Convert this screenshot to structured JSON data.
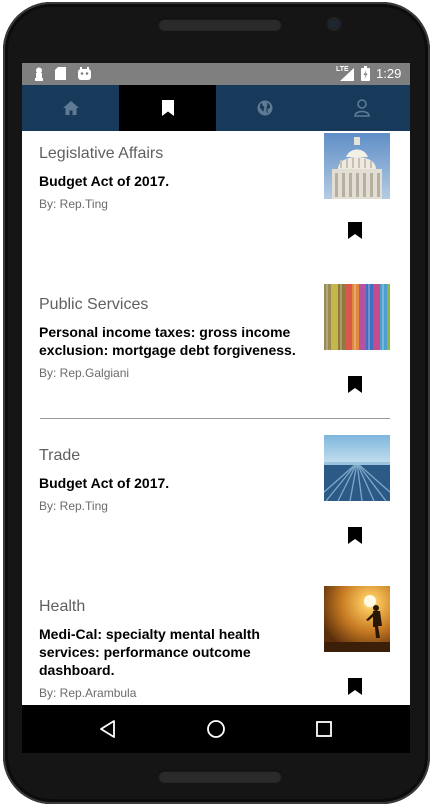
{
  "status_bar": {
    "network": "LTE",
    "time": "1:29",
    "icons": [
      "android-pawn-icon",
      "sd-card-icon",
      "android-robot-icon",
      "signal-icon",
      "battery-icon"
    ]
  },
  "tabs": [
    {
      "name": "home",
      "icon": "home-icon",
      "active": false
    },
    {
      "name": "bookmarks",
      "icon": "bookmark-icon",
      "active": true
    },
    {
      "name": "explore",
      "icon": "globe-icon",
      "active": false
    },
    {
      "name": "profile",
      "icon": "person-icon",
      "active": false
    }
  ],
  "bills": [
    {
      "category": "Legislative Affairs",
      "title": "Budget Act of 2017.",
      "author": "By: Rep.Ting",
      "image": "capitol-dome-photo"
    },
    {
      "category": "Public Services",
      "title": "Personal income taxes: gross income exclusion: mortgage debt forgiveness.",
      "author": "By: Rep.Galgiani",
      "image": "colored-pencils-photo"
    },
    {
      "category": "Trade",
      "title": "Budget Act of 2017.",
      "author": "By: Rep.Ting",
      "image": "farm-field-photo"
    },
    {
      "category": "Health",
      "title": "Medi-Cal: specialty mental health services: performance outcome dashboard.",
      "author": "By: Rep.Arambula",
      "image": "runner-sunset-photo"
    }
  ],
  "nav": {
    "back_icon": "back-icon",
    "home_icon": "home-circle-icon",
    "recents_icon": "recents-icon"
  },
  "colors": {
    "tab_bar": "#183a5a",
    "active_tab": "#000000",
    "status_bar": "#7f7f7f"
  }
}
